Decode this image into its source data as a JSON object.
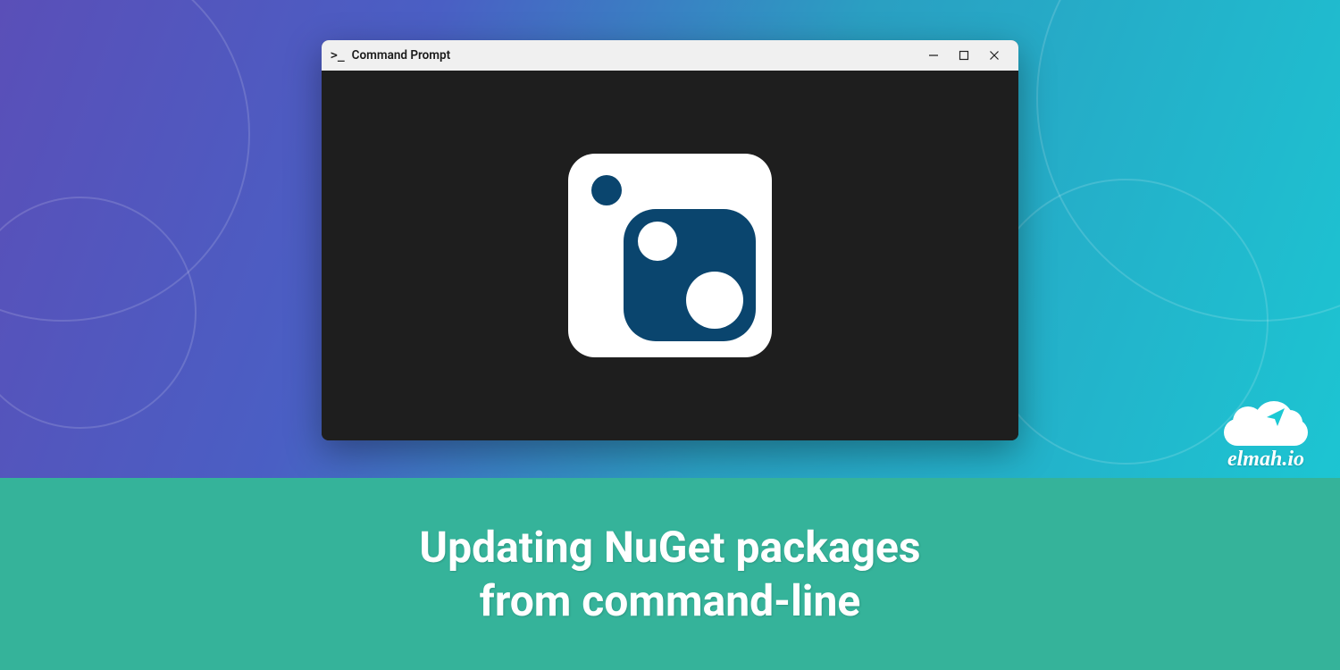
{
  "window": {
    "title": "Command Prompt",
    "icon_glyph": ">_"
  },
  "banner": {
    "line1": "Updating NuGet packages",
    "line2": "from command-line"
  },
  "brand": {
    "name": "elmah.io"
  },
  "colors": {
    "nuget_blue": "#0a456e",
    "banner_green": "#35b39a"
  }
}
